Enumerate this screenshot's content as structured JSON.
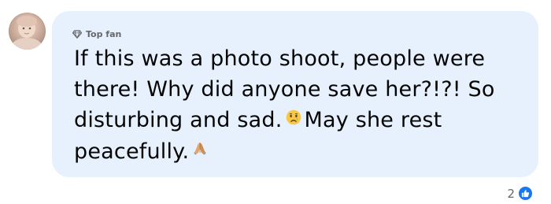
{
  "comment": {
    "badge_label": "Top fan",
    "badge_icon": "diamond-icon",
    "text_part1": "If this was a photo shoot, people were there! Why did anyone save her?!?! So disturbing and sad.",
    "text_part2": "May she rest peacefully.",
    "emoji_1": "sad-tear-face-emoji",
    "emoji_2": "folded-hands-emoji"
  },
  "reactions": {
    "count": "2",
    "icon": "like-icon",
    "like_color": "#1877f2"
  },
  "colors": {
    "bubble_background": "#e7f1fd",
    "text": "#050505",
    "secondary_text": "#65676b"
  }
}
